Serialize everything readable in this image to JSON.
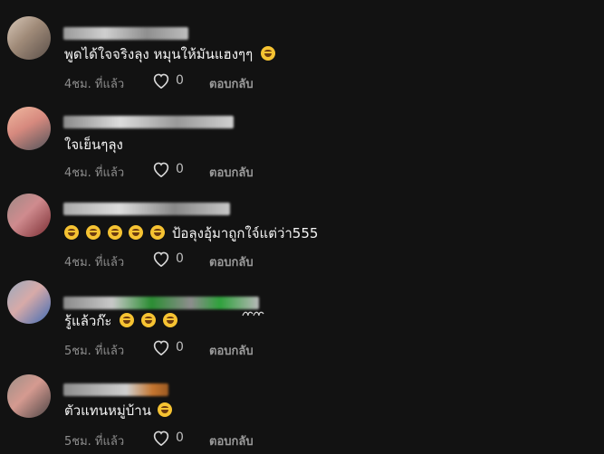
{
  "comments": [
    {
      "text": "พูดได้ใจจริงลุง หมุนให้มันแฮงๆๆ",
      "emojis_after": 1,
      "time": "4ชม. ที่แล้ว",
      "likes": "0",
      "reply": "ตอบกลับ"
    },
    {
      "text": "ใจเย็นๆลุง",
      "emojis_after": 0,
      "time": "4ชม. ที่แล้ว",
      "likes": "0",
      "reply": "ตอบกลับ"
    },
    {
      "text": "ป้อลุงอุ้มาถูกใจ์แต่ว่า555",
      "emojis_before": 5,
      "time": "4ชม. ที่แล้ว",
      "likes": "0",
      "reply": "ตอบกลับ"
    },
    {
      "text": "รู้แล้วก๊ะ",
      "emojis_after": 3,
      "time": "5ชม. ที่แล้ว",
      "likes": "0",
      "reply": "ตอบกลับ"
    },
    {
      "text": "ตัวแทนหมู่บ้าน",
      "emojis_after": 1,
      "time": "5ชม. ที่แล้ว",
      "likes": "0",
      "reply": "ตอบกลับ"
    }
  ],
  "colors": {
    "background": "#121212",
    "text": "#f4f4f4",
    "meta": "#8d8d8d",
    "emoji": "#f6c332"
  }
}
